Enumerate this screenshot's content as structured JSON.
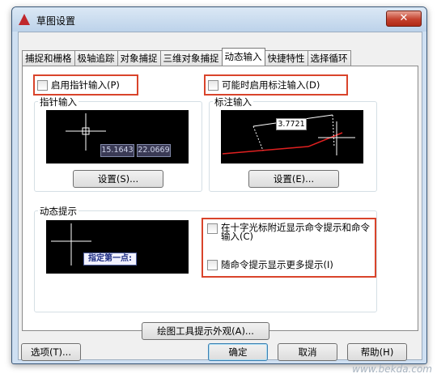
{
  "window": {
    "title": "草图设置",
    "close_label": "✕",
    "colors": {
      "title_gradient_top": "#dbe8f5",
      "close_red": "#c4412e",
      "highlight": "#d9442b"
    }
  },
  "tabs": [
    {
      "label": "捕捉和栅格"
    },
    {
      "label": "极轴追踪"
    },
    {
      "label": "对象捕捉"
    },
    {
      "label": "三维对象捕捉"
    },
    {
      "label": "动态输入",
      "active": true
    },
    {
      "label": "快捷特性"
    },
    {
      "label": "选择循环"
    }
  ],
  "pointer": {
    "enable_label": "启用指针输入(P)",
    "group_label": "指针输入",
    "preview_values": [
      "15.1643",
      "22.0669"
    ],
    "settings_button": "设置(S)..."
  },
  "dimension": {
    "enable_label": "可能时启用标注输入(D)",
    "group_label": "标注输入",
    "preview_value": "3.7721",
    "settings_button": "设置(E)..."
  },
  "dynamic_prompt": {
    "group_label": "动态提示",
    "preview_prompt": "指定第一点:",
    "option1_label": "在十字光标附近显示命令提示和命令输入(C)",
    "option2_label": "随命令提示显示更多提示(I)"
  },
  "drafting_tooltip_button": "绘图工具提示外观(A)...",
  "footer": {
    "options_button": "选项(T)...",
    "ok_button": "确定",
    "cancel_button": "取消",
    "help_button": "帮助(H)"
  },
  "watermark": "www.bekda.com"
}
